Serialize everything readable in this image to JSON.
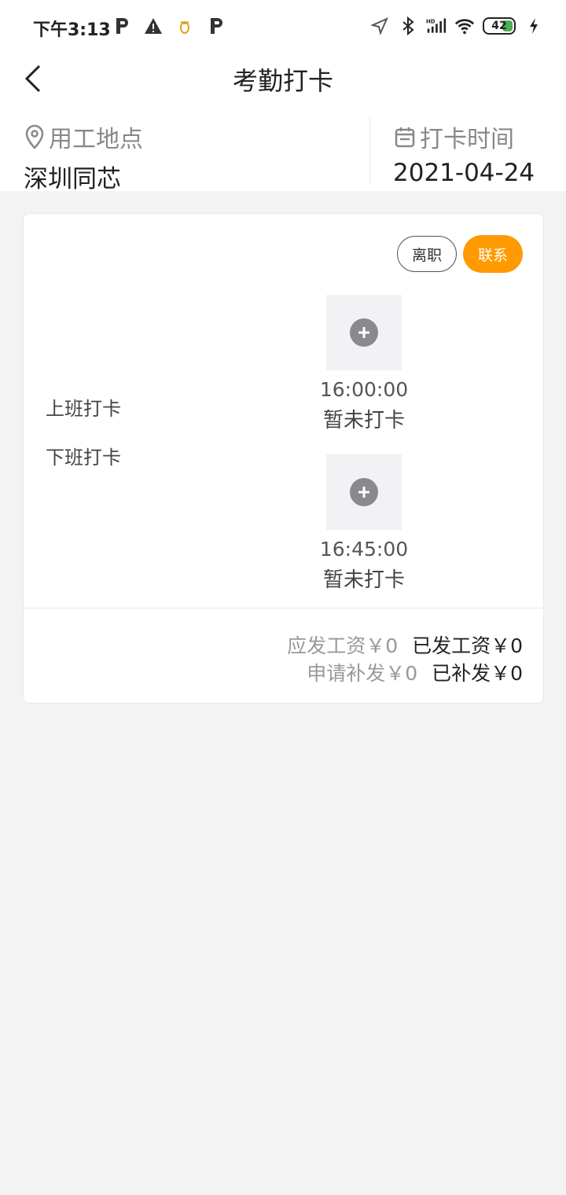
{
  "status_bar": {
    "time": "下午3:13",
    "battery": "42",
    "left_icons": [
      "parking-icon",
      "warning-icon",
      "bee-icon",
      "parking-icon"
    ],
    "right_icons": [
      "location-icon",
      "bluetooth-icon",
      "signal-hd-icon",
      "wifi-icon",
      "battery-icon",
      "charging-icon"
    ]
  },
  "header": {
    "title": "考勤打卡",
    "back_icon": "chevron-left-icon"
  },
  "info": {
    "location_label": "用工地点",
    "location_value": "深圳同芯",
    "time_label": "打卡时间",
    "time_value": "2021-04-24"
  },
  "card": {
    "resign_label": "离职",
    "contact_label": "联系",
    "accent_color": "#ff9a00",
    "clock_in_label": "上班打卡",
    "clock_out_label": "下班打卡",
    "clock_in": {
      "time": "16:00:00",
      "status": "暂未打卡"
    },
    "clock_out": {
      "time": "16:45:00",
      "status": "暂未打卡"
    },
    "wages": {
      "due": "应发工资￥0",
      "paid": "已发工资￥0",
      "apply_reissue": "申请补发￥0",
      "reissued": "已补发￥0"
    }
  }
}
